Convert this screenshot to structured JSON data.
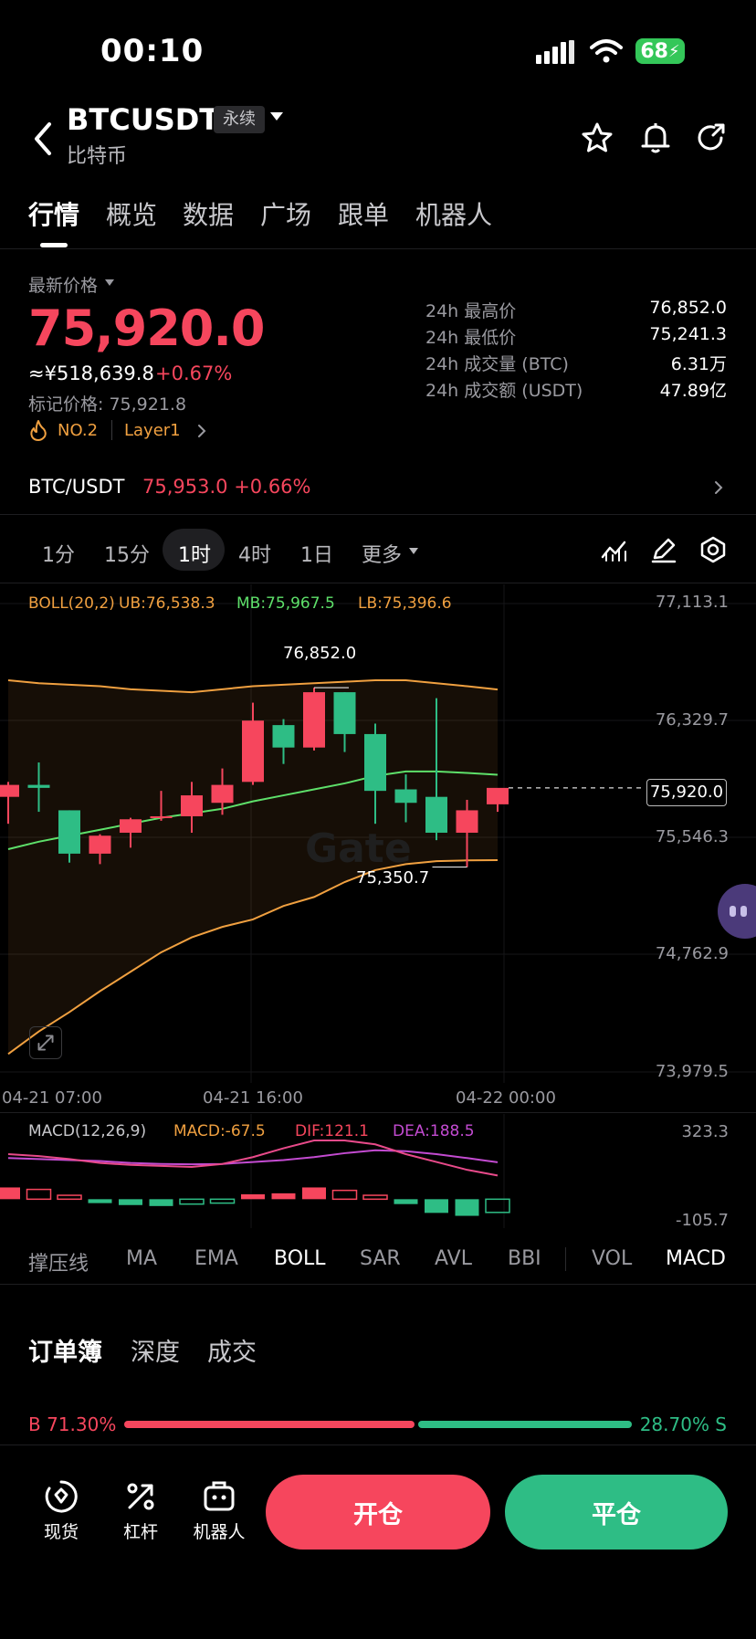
{
  "status_bar": {
    "time": "00:10",
    "battery": "68"
  },
  "header": {
    "symbol": "BTCUSDT",
    "contract_type": "永续",
    "coin_name": "比特币"
  },
  "tabs": [
    "行情",
    "概览",
    "数据",
    "广场",
    "跟单",
    "机器人"
  ],
  "price": {
    "label": "最新价格",
    "last": "75,920.0",
    "cny": "≈¥518,639.8",
    "change_pct": "+0.67%",
    "mark_price": "标记价格: 75,921.8",
    "rank": "NO.2",
    "sector": "Layer1"
  },
  "stats": [
    {
      "label": "24h 最高价",
      "value": "76,852.0"
    },
    {
      "label": "24h 最低价",
      "value": "75,241.3"
    },
    {
      "label": "24h 成交量 (BTC)",
      "value": "6.31万"
    },
    {
      "label": "24h 成交额 (USDT)",
      "value": "47.89亿"
    }
  ],
  "spot": {
    "pair": "BTC/USDT",
    "price_change": "75,953.0 +0.66%"
  },
  "intervals": [
    "1分",
    "15分",
    "1时",
    "4时",
    "1日",
    "更多"
  ],
  "selected_interval": "1时",
  "boll": {
    "title": "BOLL(20,2)",
    "ub": "UB:76,538.3",
    "mb": "MB:75,967.5",
    "lb": "LB:75,396.6"
  },
  "chart_labels": {
    "high": "76,852.0",
    "low": "75,350.7",
    "current": "75,920.0",
    "watermark": "Gate"
  },
  "chart_data": {
    "type": "candlestick",
    "y_ticks": [
      "77,113.1",
      "76,329.7",
      "75,546.3",
      "74,762.9",
      "73,979.5"
    ],
    "ylim": [
      73979.5,
      77113.1
    ],
    "x_ticks": [
      "04-21 07:00",
      "04-21 16:00",
      "04-22 00:00"
    ],
    "candles": [
      {
        "o": 75820,
        "h": 75920,
        "l": 75640,
        "c": 75900
      },
      {
        "o": 75900,
        "h": 76050,
        "l": 75720,
        "c": 75880
      },
      {
        "o": 75730,
        "h": 75730,
        "l": 75380,
        "c": 75440
      },
      {
        "o": 75440,
        "h": 75570,
        "l": 75370,
        "c": 75560
      },
      {
        "o": 75580,
        "h": 75680,
        "l": 75480,
        "c": 75670
      },
      {
        "o": 75680,
        "h": 75860,
        "l": 75660,
        "c": 75690
      },
      {
        "o": 75690,
        "h": 75920,
        "l": 75580,
        "c": 75830
      },
      {
        "o": 75780,
        "h": 76010,
        "l": 75700,
        "c": 75900
      },
      {
        "o": 75920,
        "h": 76450,
        "l": 75900,
        "c": 76330
      },
      {
        "o": 76300,
        "h": 76340,
        "l": 76040,
        "c": 76150
      },
      {
        "o": 76150,
        "h": 76550,
        "l": 76130,
        "c": 76520
      },
      {
        "o": 76520,
        "h": 76520,
        "l": 76120,
        "c": 76240
      },
      {
        "o": 76240,
        "h": 76310,
        "l": 75640,
        "c": 75860
      },
      {
        "o": 75870,
        "h": 75970,
        "l": 75650,
        "c": 75780
      },
      {
        "o": 75820,
        "h": 76480,
        "l": 75530,
        "c": 75580
      },
      {
        "o": 75580,
        "h": 75800,
        "l": 75350,
        "c": 75730
      },
      {
        "o": 75770,
        "h": 75820,
        "l": 75720,
        "c": 75880
      }
    ],
    "boll_ub": [
      76600,
      76580,
      76570,
      76560,
      76540,
      76530,
      76520,
      76540,
      76560,
      76570,
      76580,
      76590,
      76600,
      76600,
      76580,
      76560,
      76538.3
    ],
    "boll_mb": [
      75470,
      75520,
      75560,
      75600,
      75640,
      75680,
      75710,
      75740,
      75790,
      75830,
      75870,
      75910,
      75960,
      75990,
      75990,
      75980,
      75967.5
    ],
    "boll_lb": [
      74100,
      74250,
      74380,
      74520,
      74650,
      74780,
      74880,
      74950,
      75000,
      75090,
      75150,
      75250,
      75330,
      75370,
      75390,
      75395,
      75396.6
    ]
  },
  "macd": {
    "title": "MACD(12,26,9)",
    "macd": "MACD:-67.5",
    "dif": "DIF:121.1",
    "dea": "DEA:188.5",
    "max": "323.3",
    "min": "-105.7",
    "dif_values": [
      230,
      220,
      205,
      185,
      175,
      170,
      165,
      180,
      215,
      260,
      300,
      300,
      280,
      230,
      190,
      150,
      121.1
    ],
    "dea_values": [
      210,
      205,
      200,
      195,
      185,
      180,
      178,
      180,
      190,
      200,
      215,
      235,
      250,
      245,
      230,
      210,
      188.5
    ],
    "hist": [
      60,
      50,
      20,
      -20,
      -30,
      -35,
      -25,
      -20,
      25,
      30,
      60,
      45,
      20,
      -25,
      -70,
      -85,
      -67.5
    ]
  },
  "indicators": [
    "撑压线",
    "MA",
    "EMA",
    "BOLL",
    "SAR",
    "AVL",
    "BBI",
    "VOL",
    "MACD"
  ],
  "active_indicators": [
    "BOLL",
    "MACD"
  ],
  "orderbook": {
    "tabs": [
      "订单簿",
      "深度",
      "成交"
    ],
    "buy_pct": "B 71.30%",
    "sell_pct": "28.70% S",
    "buy_ratio": 0.713
  },
  "bottom_nav": {
    "items": [
      "现货",
      "杠杆",
      "机器人"
    ],
    "open": "开仓",
    "close": "平仓"
  },
  "colors": {
    "up": "#f6465d",
    "down": "#2ebd85",
    "boll_band": "#f0a040",
    "boll_mid": "#5ee06a"
  }
}
